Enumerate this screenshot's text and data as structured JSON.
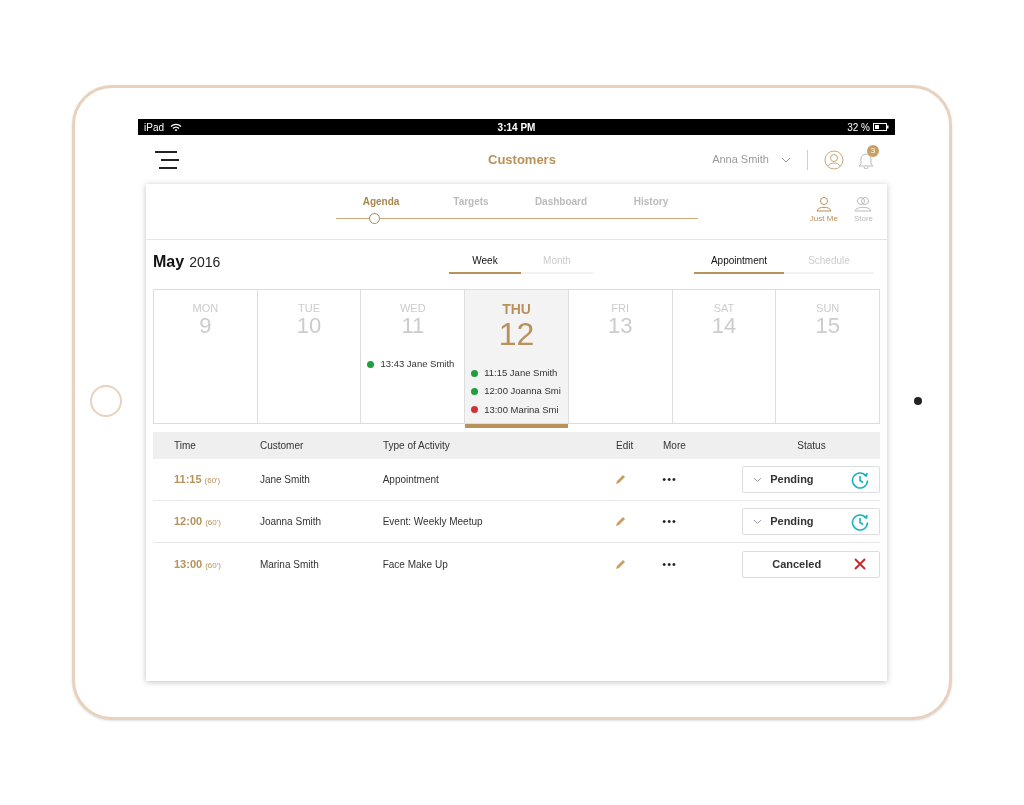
{
  "status_bar": {
    "device": "iPad",
    "time": "3:14 PM",
    "battery": "32 %"
  },
  "header": {
    "title": "Customers",
    "user": "Anna Smith",
    "notifications": "3"
  },
  "nav_tabs": [
    {
      "label": "Agenda",
      "selected": true
    },
    {
      "label": "Targets",
      "selected": false
    },
    {
      "label": "Dashboard",
      "selected": false
    },
    {
      "label": "History",
      "selected": false
    }
  ],
  "scope": [
    {
      "label": "Just Me",
      "selected": true
    },
    {
      "label": "Store",
      "selected": false
    }
  ],
  "period": {
    "month": "May",
    "year": "2016"
  },
  "view_toggle": [
    {
      "label": "Week",
      "selected": true
    },
    {
      "label": "Month",
      "selected": false
    }
  ],
  "type_toggle": [
    {
      "label": "Appointment",
      "selected": true
    },
    {
      "label": "Schedule",
      "selected": false
    }
  ],
  "days": [
    {
      "weekday": "MON",
      "date": "9",
      "selected": false
    },
    {
      "weekday": "TUE",
      "date": "10",
      "selected": false
    },
    {
      "weekday": "WED",
      "date": "11",
      "selected": false,
      "events": [
        {
          "text": "13:43 Jane Smith",
          "color": "#1e9e3e"
        }
      ]
    },
    {
      "weekday": "THU",
      "date": "12",
      "selected": true,
      "events": [
        {
          "text": "11:15 Jane Smith",
          "color": "#1e9e3e"
        },
        {
          "text": "12:00 Joanna Smi",
          "color": "#1e9e3e"
        },
        {
          "text": "13:00 Marina Smi",
          "color": "#d0303a"
        }
      ]
    },
    {
      "weekday": "FRI",
      "date": "13",
      "selected": false
    },
    {
      "weekday": "SAT",
      "date": "14",
      "selected": false
    },
    {
      "weekday": "SUN",
      "date": "15",
      "selected": false
    }
  ],
  "table": {
    "columns": [
      "Time",
      "Customer",
      "Type of Activity",
      "Edit",
      "More",
      "Status"
    ],
    "rows": [
      {
        "time": "11:15",
        "duration": "(60')",
        "customer": "Jane Smith",
        "activity": "Appointment",
        "more": "•••",
        "status": {
          "kind": "pending",
          "label": "Pending"
        }
      },
      {
        "time": "12:00",
        "duration": "(60')",
        "customer": "Joanna Smith",
        "activity": "Event: Weekly Meetup",
        "more": "•••",
        "status": {
          "kind": "pending",
          "label": "Pending"
        }
      },
      {
        "time": "13:00",
        "duration": "(60')",
        "customer": "Marina Smith",
        "activity": "Face Make Up",
        "more": "•••",
        "status": {
          "kind": "canceled",
          "label": "Canceled"
        }
      }
    ]
  }
}
